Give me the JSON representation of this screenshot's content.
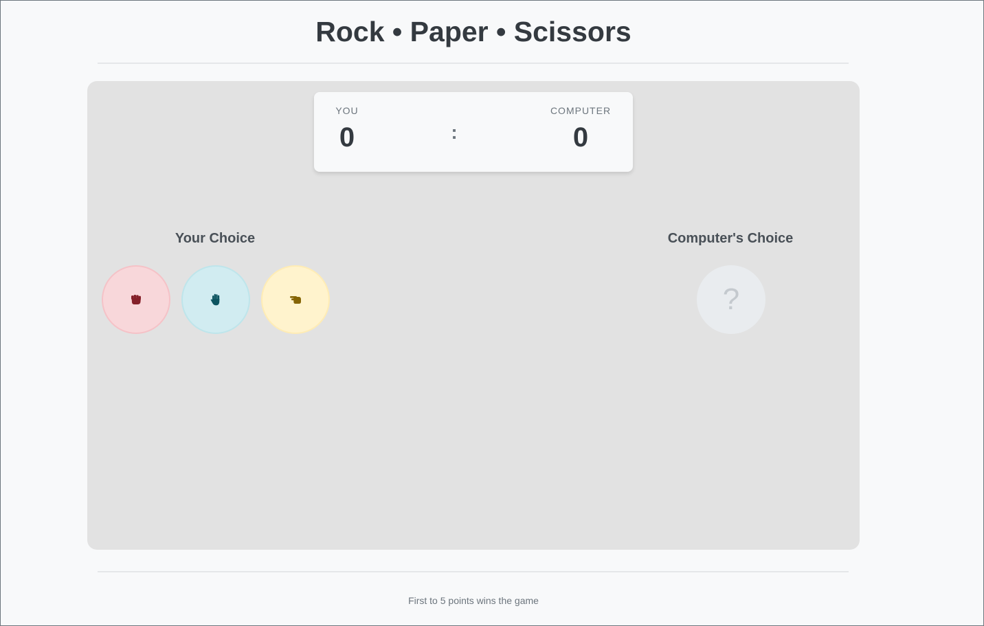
{
  "header": {
    "title": "Rock • Paper • Scissors"
  },
  "scoreboard": {
    "you_label": "YOU",
    "you_score": "0",
    "separator": ":",
    "computer_label": "COMPUTER",
    "computer_score": "0"
  },
  "player": {
    "heading": "Your Choice",
    "choices": [
      {
        "label": "Rock",
        "icon": "fist-icon",
        "bg": "#f8d7da",
        "color": "#842029"
      },
      {
        "label": "Paper",
        "icon": "hand-icon",
        "bg": "#d1ecf1",
        "color": "#0c5460"
      },
      {
        "label": "Scissors",
        "icon": "scissors-hand-icon",
        "bg": "#fff3cd",
        "color": "#856404"
      }
    ]
  },
  "computer": {
    "heading": "Computer's Choice",
    "placeholder": "?"
  },
  "footer": {
    "note": "First to 5 points wins the game"
  }
}
